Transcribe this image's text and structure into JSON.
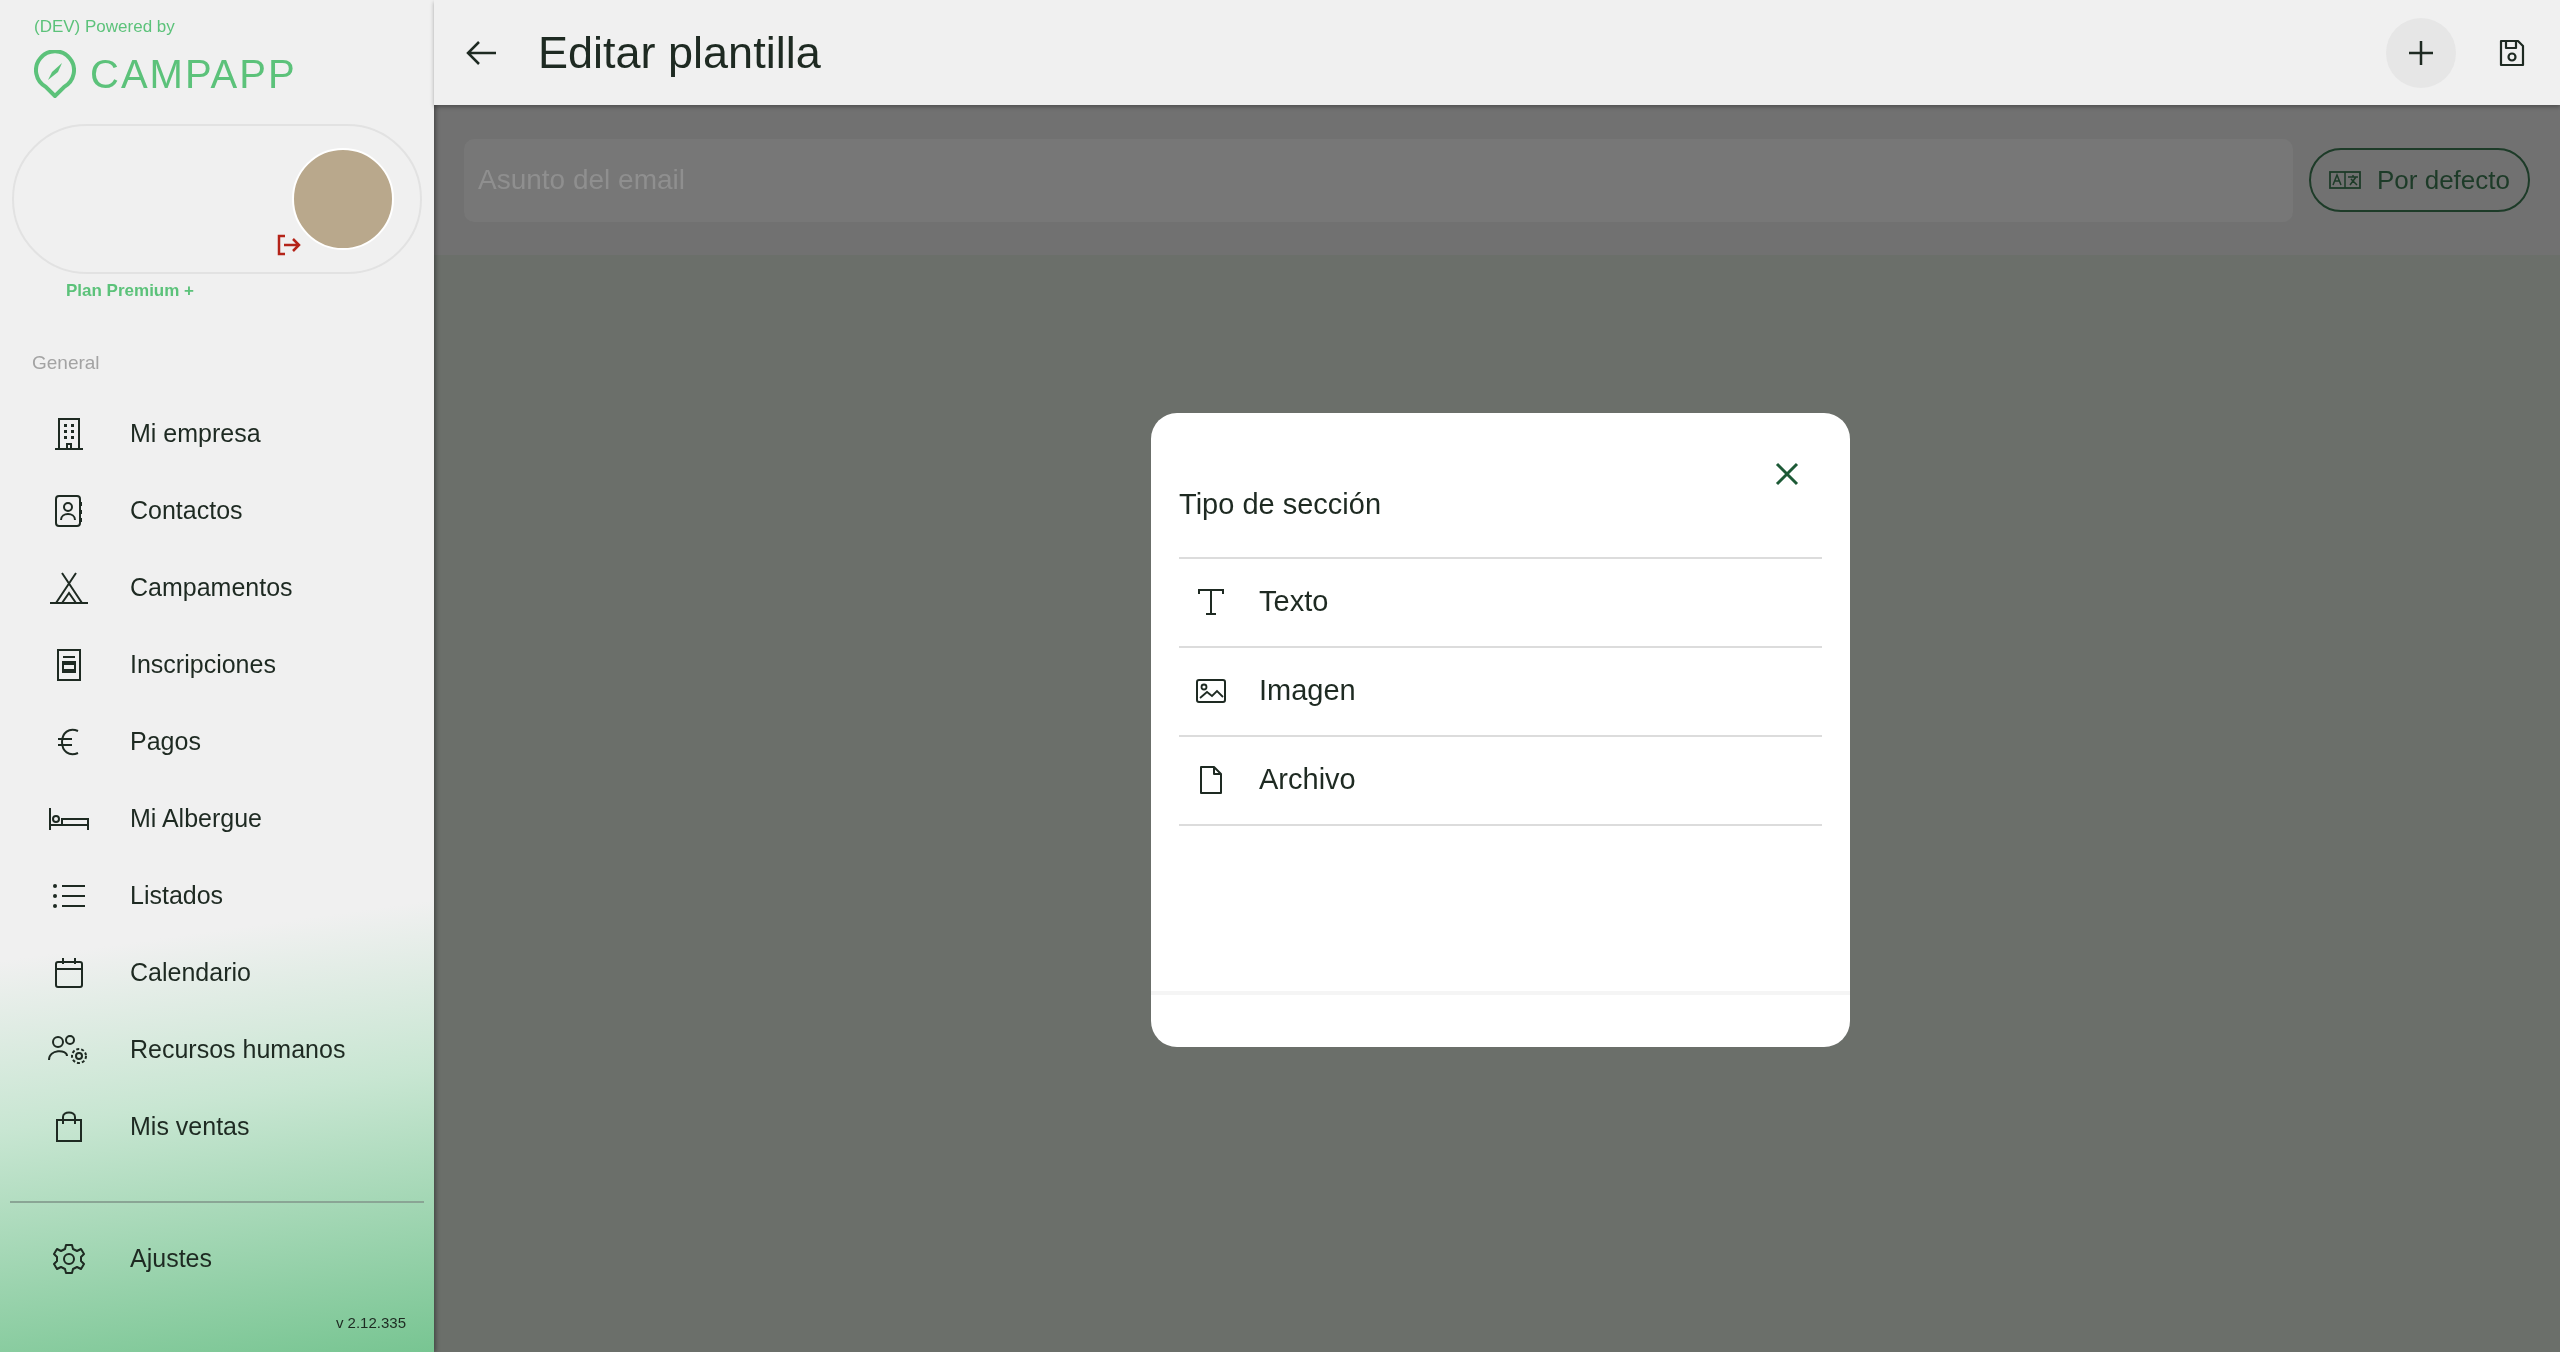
{
  "sidebar": {
    "powered_by": "(DEV) Powered by",
    "logo_text": "CAMPAPP",
    "plan": "Plan Premium +",
    "section_label": "General",
    "items": [
      {
        "label": "Mi empresa",
        "kind": "building"
      },
      {
        "label": "Contactos",
        "kind": "contacts"
      },
      {
        "label": "Campamentos",
        "kind": "tent"
      },
      {
        "label": "Inscripciones",
        "kind": "form"
      },
      {
        "label": "Pagos",
        "kind": "euro"
      },
      {
        "label": "Mi Albergue",
        "kind": "bed"
      },
      {
        "label": "Listados",
        "kind": "list"
      },
      {
        "label": "Calendario",
        "kind": "calendar"
      },
      {
        "label": "Recursos humanos",
        "kind": "people"
      },
      {
        "label": "Mis ventas",
        "kind": "bag"
      }
    ],
    "footer_items": [
      {
        "label": "Ajustes",
        "kind": "gear"
      }
    ],
    "version": "v 2.12.335"
  },
  "header": {
    "title": "Editar plantilla"
  },
  "subject_field": {
    "placeholder": "Asunto del email"
  },
  "language_button": {
    "label": "Por defecto"
  },
  "dialog": {
    "title": "Tipo de sección",
    "options": [
      {
        "label": "Texto",
        "kind": "text"
      },
      {
        "label": "Imagen",
        "kind": "image"
      },
      {
        "label": "Archivo",
        "kind": "file"
      }
    ]
  }
}
